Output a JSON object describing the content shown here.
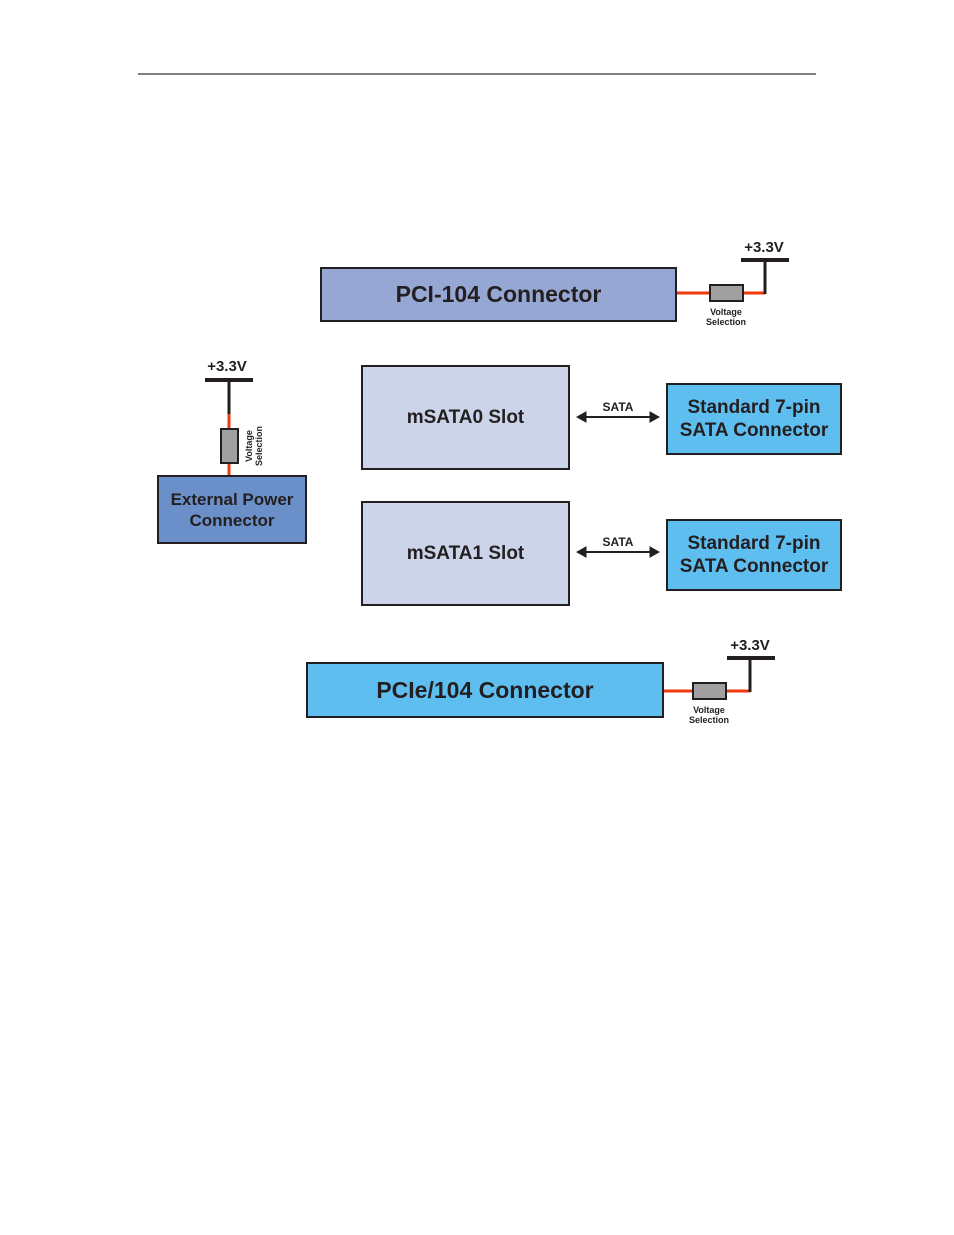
{
  "colors": {
    "pci104": "#97a7d3",
    "external_power": "#6a8fc9",
    "msata_slot": "#cbd4e8",
    "sata_connector": "#5fbef0",
    "pcie104": "#5fbef0",
    "power_line": "#ee3a0f",
    "resistor": "#a0a0a0",
    "outline": "#231f20"
  },
  "pci104": {
    "label": "PCI-104 Connector",
    "voltage": "+3.3V",
    "selection": [
      "Voltage",
      "Selection"
    ]
  },
  "external_power": {
    "label": [
      "External Power",
      "Connector"
    ],
    "voltage": "+3.3V",
    "selection": [
      "Voltage",
      "Selection"
    ]
  },
  "msata0": {
    "label": "mSATA0 Slot",
    "link": "SATA",
    "connector": [
      "Standard 7-pin",
      "SATA Connector"
    ]
  },
  "msata1": {
    "label": "mSATA1 Slot",
    "link": "SATA",
    "connector": [
      "Standard 7-pin",
      "SATA Connector"
    ]
  },
  "pcie104": {
    "label": "PCIe/104 Connector",
    "voltage": "+3.3V",
    "selection": [
      "Voltage",
      "Selection"
    ]
  }
}
